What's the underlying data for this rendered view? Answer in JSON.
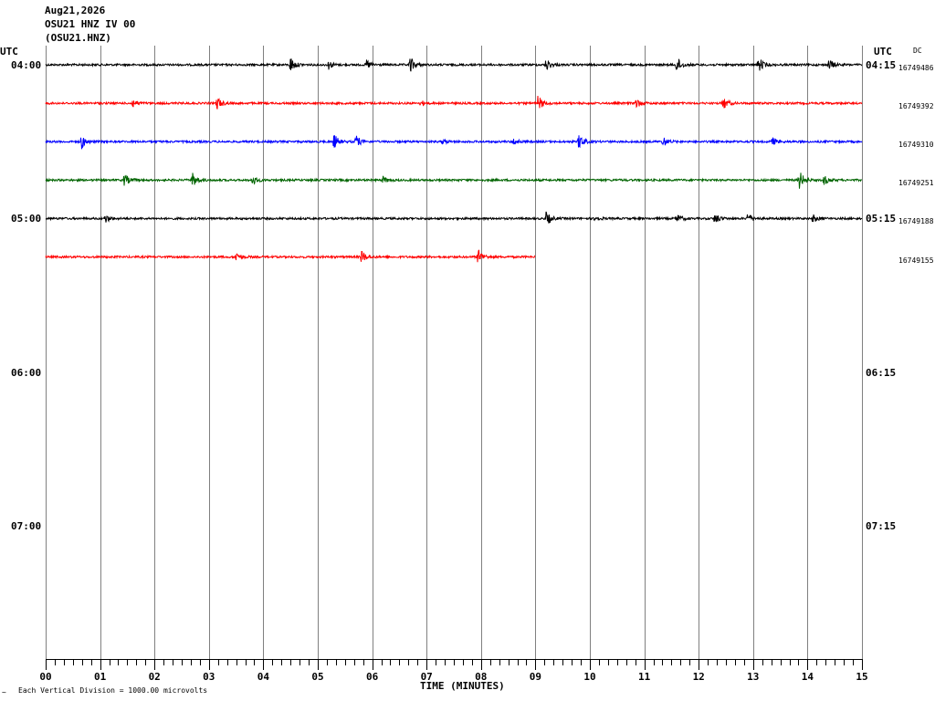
{
  "header": {
    "date": "Aug21,2026",
    "channel": "OSU21 HNZ IV 00",
    "station_code": "(OSU21.HNZ)"
  },
  "left_tz": "UTC",
  "right_tz": "UTC",
  "dc_label": "DC",
  "footer": {
    "scale_note": "Each Vertical Division = 1000.00 microvolts",
    "corner_mark": "~"
  },
  "colors": {
    "black": "#000000",
    "red": "#ff0000",
    "blue": "#0000ff",
    "green": "#006400",
    "grid": "#808080"
  },
  "chart_data": {
    "type": "line",
    "title": "",
    "xlabel": "TIME (MINUTES)",
    "ylabel": "",
    "xlim": [
      0,
      15
    ],
    "x_ticks": [
      "00",
      "01",
      "02",
      "03",
      "04",
      "05",
      "06",
      "07",
      "08",
      "09",
      "10",
      "11",
      "12",
      "13",
      "14",
      "15"
    ],
    "hour_labels_left": [
      "04:00",
      "05:00",
      "06:00",
      "07:00"
    ],
    "hour_labels_right": [
      "04:15",
      "05:15",
      "06:15",
      "07:15"
    ],
    "traces": [
      {
        "start": "04:00",
        "color": "#000000",
        "dc_offset": "16749486",
        "end_min": 15,
        "events": [
          [
            4.5,
            1.0
          ],
          [
            5.2,
            0.5
          ],
          [
            5.9,
            0.6
          ],
          [
            6.7,
            1.0
          ],
          [
            9.2,
            0.8
          ],
          [
            11.6,
            1.0
          ],
          [
            13.1,
            1.0
          ],
          [
            14.4,
            0.7
          ]
        ]
      },
      {
        "start": "04:15",
        "color": "#ff0000",
        "dc_offset": "16749392",
        "end_min": 15,
        "events": [
          [
            1.6,
            0.5
          ],
          [
            3.15,
            0.8
          ],
          [
            6.9,
            0.3
          ],
          [
            9.05,
            1.0
          ],
          [
            10.85,
            0.6
          ],
          [
            12.45,
            0.8
          ]
        ]
      },
      {
        "start": "04:30",
        "color": "#0000ff",
        "dc_offset": "16749310",
        "end_min": 15,
        "events": [
          [
            0.65,
            1.0
          ],
          [
            5.3,
            0.9
          ],
          [
            5.7,
            0.8
          ],
          [
            7.3,
            0.3
          ],
          [
            8.6,
            0.4
          ],
          [
            9.8,
            1.0
          ],
          [
            11.35,
            0.6
          ],
          [
            13.35,
            0.5
          ]
        ]
      },
      {
        "start": "04:45",
        "color": "#006400",
        "dc_offset": "16749251",
        "end_min": 15,
        "events": [
          [
            1.45,
            0.8
          ],
          [
            2.7,
            0.9
          ],
          [
            3.8,
            0.6
          ],
          [
            6.2,
            0.4
          ],
          [
            13.85,
            1.2
          ],
          [
            14.3,
            0.6
          ]
        ]
      },
      {
        "start": "05:00",
        "color": "#000000",
        "dc_offset": "16749188",
        "end_min": 15,
        "events": [
          [
            1.1,
            0.5
          ],
          [
            9.2,
            0.9
          ],
          [
            10.1,
            0.3
          ],
          [
            11.6,
            0.6
          ],
          [
            12.3,
            0.7
          ],
          [
            12.9,
            0.7
          ],
          [
            14.1,
            0.5
          ]
        ]
      },
      {
        "start": "05:15",
        "color": "#ff0000",
        "dc_offset": "16749155",
        "end_min": 9.0,
        "events": [
          [
            3.5,
            0.6
          ],
          [
            5.8,
            0.8
          ],
          [
            7.95,
            1.0
          ]
        ]
      }
    ]
  }
}
